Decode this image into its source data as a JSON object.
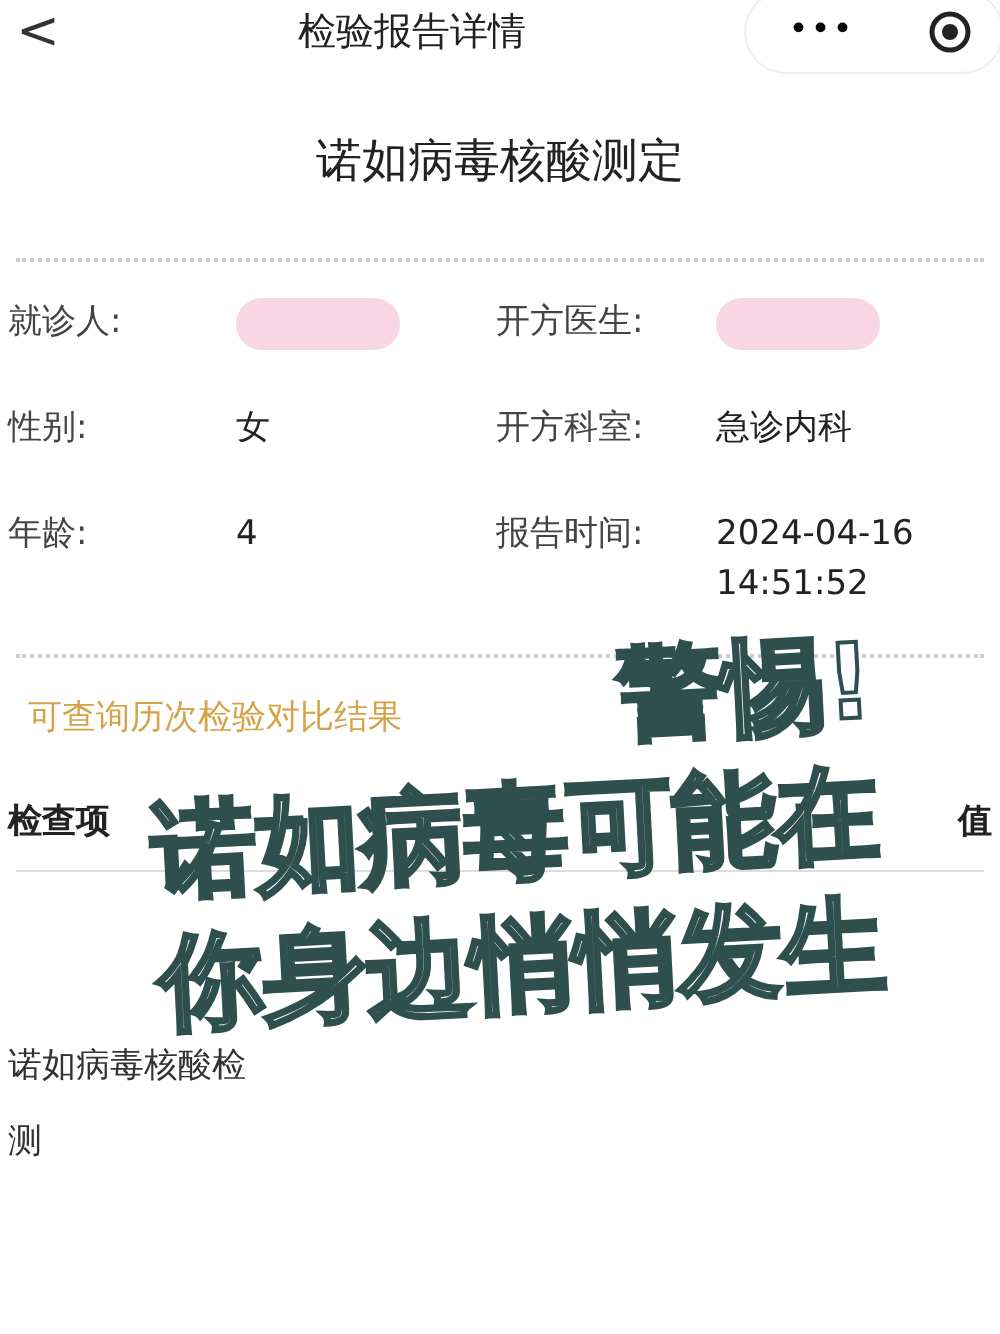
{
  "header": {
    "back": "<",
    "title": "检验报告详情",
    "more": "•••"
  },
  "report_title": "诺如病毒核酸测定",
  "info_rows": [
    {
      "cells": [
        {
          "label": "就诊人:",
          "kind": "redacted"
        },
        {
          "label": "开方医生:",
          "kind": "redacted"
        }
      ]
    },
    {
      "cells": [
        {
          "label": "性别:",
          "kind": "text",
          "value": "女"
        },
        {
          "label": "开方科室:",
          "kind": "text",
          "value": "急诊内科"
        }
      ]
    },
    {
      "cells": [
        {
          "label": "年龄:",
          "kind": "text",
          "value": "4"
        },
        {
          "label": "报告时间:",
          "kind": "text",
          "value": "2024-04-16 14:51:52"
        }
      ]
    }
  ],
  "hint": "可查询历次检验对比结果",
  "table": {
    "columns": [
      "检查项",
      "值"
    ],
    "rows": [
      {
        "item": "诺如病毒核酸检测"
      }
    ]
  },
  "caption": [
    "警惕!",
    "诺如病毒可能在",
    "你身边悄悄发生"
  ]
}
